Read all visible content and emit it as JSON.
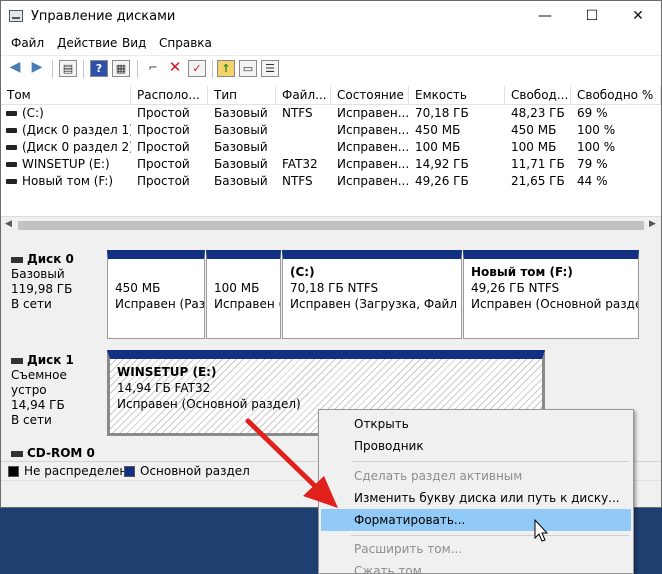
{
  "window": {
    "title": "Управление дисками",
    "controls": {
      "minimize": "—",
      "maximize": "☐",
      "close": "✕"
    }
  },
  "menu": [
    "Файл",
    "Действие",
    "Вид",
    "Справка"
  ],
  "toolbar": {
    "icons": [
      "back-icon",
      "forward-icon",
      "disk-list-icon",
      "help-icon",
      "console-icon",
      "connect-icon",
      "delete-icon",
      "check-icon",
      "folder-up-icon",
      "properties-icon"
    ]
  },
  "volume_table": {
    "columns": [
      "Том",
      "Располо...",
      "Тип",
      "Файл...",
      "Состояние",
      "Емкость",
      "Свобод...",
      "Свободно %"
    ],
    "rows": [
      [
        "(C:)",
        "Простой",
        "Базовый",
        "NTFS",
        "Исправен...",
        "70,18 ГБ",
        "48,23 ГБ",
        "69 %"
      ],
      [
        "(Диск 0 раздел 1)",
        "Простой",
        "Базовый",
        "",
        "Исправен...",
        "450 МБ",
        "450 МБ",
        "100 %"
      ],
      [
        "(Диск 0 раздел 2)",
        "Простой",
        "Базовый",
        "",
        "Исправен...",
        "100 МБ",
        "100 МБ",
        "100 %"
      ],
      [
        "WINSETUP (E:)",
        "Простой",
        "Базовый",
        "FAT32",
        "Исправен...",
        "14,92 ГБ",
        "11,71 ГБ",
        "79 %"
      ],
      [
        "Новый том (F:)",
        "Простой",
        "Базовый",
        "NTFS",
        "Исправен...",
        "49,26 ГБ",
        "21,65 ГБ",
        "44 %"
      ]
    ]
  },
  "disks": [
    {
      "name": "Диск 0",
      "type": "Базовый",
      "size": "119,98 ГБ",
      "status": "В сети",
      "partitions": [
        {
          "name": "",
          "size": "450 МБ",
          "status": "Исправен (Раз"
        },
        {
          "name": "",
          "size": "100 МБ",
          "status": "Исправен ("
        },
        {
          "name": "(C:)",
          "size": "70,18 ГБ NTFS",
          "status": "Исправен (Загрузка, Файл подк"
        },
        {
          "name": "Новый том  (F:)",
          "size": "49,26 ГБ NTFS",
          "status": "Исправен (Основной раздел)"
        }
      ]
    },
    {
      "name": "Диск 1",
      "type": "Съемное устро",
      "size": "14,94 ГБ",
      "status": "В сети",
      "partitions": [
        {
          "name": "WINSETUP  (E:)",
          "size": "14,94 ГБ FAT32",
          "status": "Исправен (Основной раздел)"
        }
      ]
    },
    {
      "name": "CD-ROM 0"
    }
  ],
  "legend": [
    {
      "label": "Не распределена",
      "color": "#000000"
    },
    {
      "label": "Основной раздел",
      "color": "#112f83"
    }
  ],
  "context_menu": {
    "items": [
      {
        "label": "Открыть",
        "disabled": false
      },
      {
        "label": "Проводник",
        "disabled": false
      },
      {
        "label": "Сделать раздел активным",
        "disabled": true
      },
      {
        "label": "Изменить букву диска или путь к диску...",
        "disabled": false
      },
      {
        "label": "Форматировать...",
        "disabled": false,
        "highlighted": true
      },
      {
        "label": "Расширить том...",
        "disabled": true
      },
      {
        "label": "Сжать том...",
        "disabled": true
      }
    ]
  },
  "annotation": {
    "arrow_color": "#e0201b"
  }
}
